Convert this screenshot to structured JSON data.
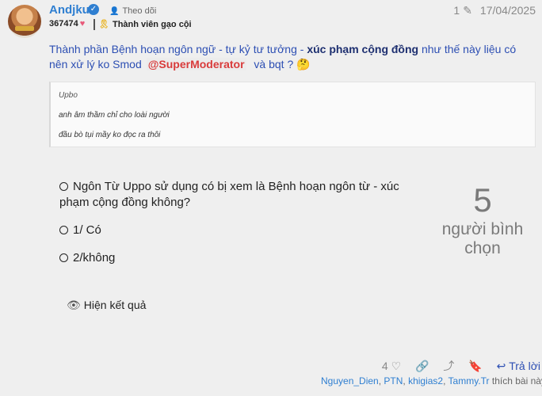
{
  "post": {
    "username": "Andjku",
    "follow_label": "Theo dõi",
    "points": "367474",
    "rank": "Thành viên gạo cội",
    "edit_count": "1",
    "date": "17/04/2025",
    "text": {
      "part1": "Thành phần Bệnh hoạn ngôn ngữ - tự kỷ tư tưởng - ",
      "bold": "xúc phạm cộng đồng",
      "part2": " như thế này liệu có nên xử lý ko Smod",
      "mention": "@SuperModerator",
      "part3": " và bqt ? 🤔"
    },
    "quote": {
      "author": "Upbo",
      "lines": [
        "anh âm thầm chỉ cho loài người",
        "đầu bò tụi mầy ko đọc ra thôi"
      ]
    }
  },
  "poll": {
    "question": "Ngôn Từ Uppo sử dụng có bị xem là Bệnh hoạn ngôn từ - xúc phạm cộng đồng không?",
    "options": [
      "1/ Có",
      "2/không"
    ],
    "voter_count": "5",
    "voter_label": "người bình chọn",
    "show_results": "Hiện kết quả"
  },
  "actions": {
    "like_count": "4",
    "reply_label": "Trả lời"
  },
  "liked_by": {
    "users": [
      "Nguyen_Dien",
      "PTN",
      "khigias2",
      "Tammy.Tr"
    ],
    "suffix": " thích bài này"
  }
}
